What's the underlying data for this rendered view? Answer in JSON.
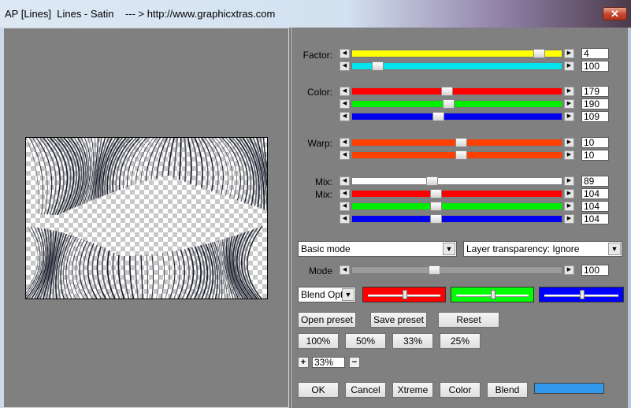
{
  "window": {
    "title": "AP [Lines]  Lines - Satin    --- > http://www.graphicxtras.com",
    "close_symbol": "✕"
  },
  "icons": {
    "arrow_left": "◀",
    "arrow_right": "▶",
    "dropdown": "▼"
  },
  "labels": {
    "factor": "Factor:",
    "color": "Color:",
    "warp": "Warp:",
    "mix1": "Mix:",
    "mix2": "Mix:",
    "mode": "Mode"
  },
  "sliders": [
    {
      "id": "factor-1",
      "fill": "#ffff00",
      "value": "4",
      "pos": 0.89
    },
    {
      "id": "factor-2",
      "fill": "#00e5ee",
      "value": "100",
      "pos": 0.12
    },
    {
      "id": "color-red",
      "fill": "#ff0000",
      "value": "179",
      "pos": 0.45
    },
    {
      "id": "color-green",
      "fill": "#00ee00",
      "value": "190",
      "pos": 0.46
    },
    {
      "id": "color-blue",
      "fill": "#0000ee",
      "value": "109",
      "pos": 0.41
    },
    {
      "id": "warp-1",
      "fill": "#ff4000",
      "value": "10",
      "pos": 0.52
    },
    {
      "id": "warp-2",
      "fill": "#ff4000",
      "value": "10",
      "pos": 0.52
    },
    {
      "id": "mix-white",
      "fill": "#ffffff",
      "value": "89",
      "pos": 0.38
    },
    {
      "id": "mix-red",
      "fill": "#ff0000",
      "value": "104",
      "pos": 0.4
    },
    {
      "id": "mix-green",
      "fill": "#00ee00",
      "value": "104",
      "pos": 0.4
    },
    {
      "id": "mix-blue",
      "fill": "#0000ee",
      "value": "104",
      "pos": 0.4
    },
    {
      "id": "mode",
      "fill": "#9c9c9c",
      "value": "100",
      "pos": 0.39
    }
  ],
  "selects": {
    "mode": "Basic mode",
    "transparency": "Layer transparency: Ignore",
    "blend": "Blend Opti"
  },
  "blend_boxes": [
    {
      "id": "red",
      "color": "#ff0000",
      "pos": 0.5
    },
    {
      "id": "green",
      "color": "#00ff00",
      "pos": 0.5
    },
    {
      "id": "blue",
      "color": "#0000ff",
      "pos": 0.5
    }
  ],
  "buttons": {
    "open_preset": "Open preset",
    "save_preset": "Save preset",
    "reset": "Reset",
    "zoom100": "100%",
    "zoom50": "50%",
    "zoom33": "33%",
    "zoom25": "25%",
    "zoom_in": "+",
    "zoom_out": "−",
    "zoom_value": "33%",
    "ok": "OK",
    "cancel": "Cancel",
    "xtreme": "Xtreme",
    "color": "Color",
    "blend": "Blend"
  },
  "blend_color_swatch": "#3399ee"
}
